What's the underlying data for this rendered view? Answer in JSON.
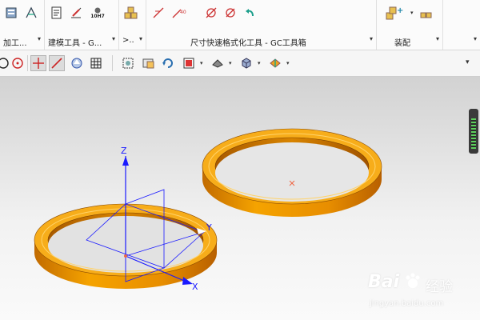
{
  "ribbon": {
    "groups": [
      {
        "label": "加工...",
        "dropdown": "▾"
      },
      {
        "label": "建模工具 - G...",
        "dropdown": "▾"
      },
      {
        "label": ">..",
        "dropdown": "▾"
      },
      {
        "label": "尺寸快速格式化工具 - GC工具箱",
        "dropdown": "▾"
      },
      {
        "label": "装配",
        "dropdown": "▾"
      },
      {
        "label": "",
        "dropdown": "▾"
      }
    ],
    "buttons": {
      "tolerance_label": "10H7"
    }
  },
  "viewport": {
    "axes": {
      "z": "Z",
      "y": "Y",
      "x": "X"
    }
  },
  "watermark": {
    "text_latin": "Bai",
    "text_cn": "经验",
    "url": "jingyan.baidu.com"
  },
  "colors": {
    "ring_orange": "#F5A300",
    "axis_blue": "#1a1aff",
    "watermark": "#ffffff"
  }
}
